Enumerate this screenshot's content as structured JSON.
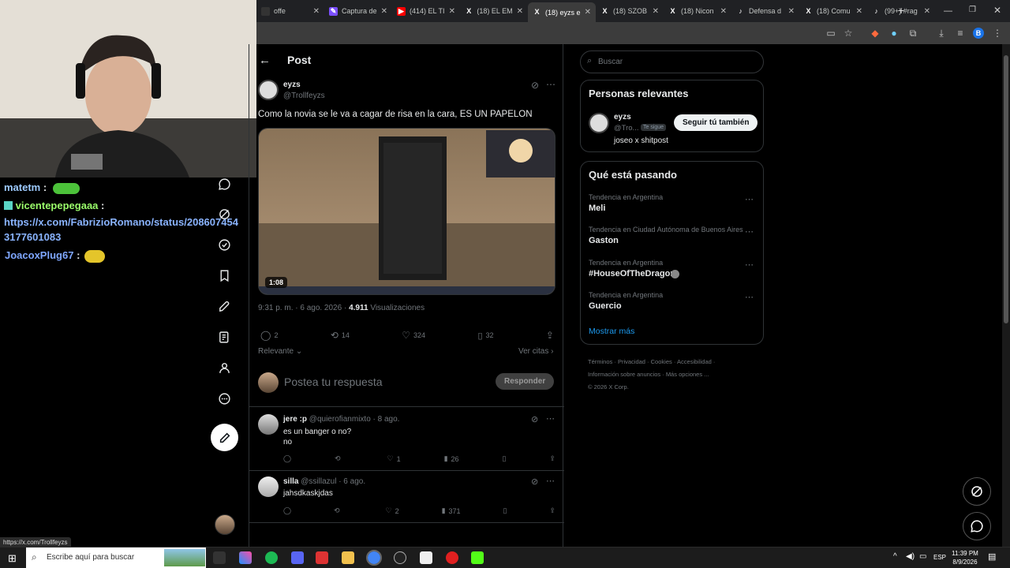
{
  "browser": {
    "tabs": [
      {
        "label": "offe",
        "icon": "generic-icon",
        "color": "#333"
      },
      {
        "label": "Captura de",
        "icon": "pen-icon",
        "color": "#7b4fff"
      },
      {
        "label": "(414) EL TI",
        "icon": "youtube-icon",
        "color": "#ff0000"
      },
      {
        "label": "(18) EL EM",
        "icon": "x-icon",
        "color": "#000"
      },
      {
        "label": "(18) eyzs e",
        "icon": "x-icon",
        "color": "#000",
        "active": true
      },
      {
        "label": "(18) SZOB",
        "icon": "x-icon",
        "color": "#000"
      },
      {
        "label": "(18) Nicon",
        "icon": "x-icon",
        "color": "#000"
      },
      {
        "label": "Defensa d",
        "icon": "tiktok-icon",
        "color": "#000"
      },
      {
        "label": "(18) Comu",
        "icon": "x-icon",
        "color": "#000"
      },
      {
        "label": "(99+) #rag",
        "icon": "tiktok-icon",
        "color": "#000"
      }
    ],
    "new_tab": "+",
    "profile_initial": "B"
  },
  "stream_chat": [
    {
      "user": "matetm",
      "color": "#9ecbff",
      "msg": ":",
      "emote": "green-emote"
    },
    {
      "user": "vicentepepegaaa",
      "color": "#9bff6b",
      "msg": ":",
      "badge": true
    },
    {
      "link": "https://x.com/FabrizioRomano/status/2086074543177601083"
    },
    {
      "user": "JoacoxPlug67",
      "color": "#7fa7ff",
      "msg": ":",
      "emote": "minion-emote"
    }
  ],
  "post": {
    "header": "Post",
    "author_name": "eyzs",
    "author_handle": "@Trollfeyzs",
    "text": "Como la novia se le va a cagar de risa en la cara, ES UN PAPELON",
    "video_duration": "1:08",
    "timestamp": "9:31 p. m. · 6 ago. 2026 · ",
    "views_count": "4.911",
    "views_label": "Visualizaciones",
    "replies": "2",
    "reposts": "14",
    "likes": "324",
    "bookmarks": "32",
    "sort_label": "Relevante",
    "quotes_label": "Ver citas",
    "reply_placeholder": "Postea tu respuesta",
    "reply_button": "Responder"
  },
  "replies": [
    {
      "name": "jere :p",
      "handle": "@quierofianmixto",
      "date": "· 8 ago.",
      "lines": [
        "es un banger o no?",
        "no"
      ],
      "reposts": "",
      "likes": "1",
      "views": "26"
    },
    {
      "name": "silla",
      "handle": "@ssillazul",
      "date": "· 6 ago.",
      "lines": [
        "jahsdkaskjdas"
      ],
      "reposts": "",
      "likes": "2",
      "views": "371"
    }
  ],
  "sidebar": {
    "search_placeholder": "Buscar",
    "relevant_title": "Personas relevantes",
    "relevant_name": "eyzs",
    "relevant_handle": "@Tro...",
    "follows_you": "Te sigue",
    "follow_button": "Seguir tú también",
    "relevant_bio": "joseo x shitpost",
    "trends_title": "Qué está pasando",
    "trends": [
      {
        "cat": "Tendencia en Argentina",
        "name": "Meli"
      },
      {
        "cat": "Tendencia en Ciudad Autónoma de Buenos Aires",
        "name": "Gaston"
      },
      {
        "cat": "Tendencia en Argentina",
        "name": "#HouseOfTheDragon"
      },
      {
        "cat": "Tendencia en Argentina",
        "name": "Guercio"
      }
    ],
    "show_more": "Mostrar más",
    "footer_line1": [
      "Términos",
      "Privacidad",
      "Cookies",
      "Accesibilidad"
    ],
    "footer_line2": [
      "Información sobre anuncios",
      "Más opciones ..."
    ],
    "copyright": "© 2026 X Corp."
  },
  "status_url": "https://x.com/Trollfeyzs",
  "taskbar": {
    "search_placeholder": "Escribe aquí para buscar",
    "language": "ESP",
    "time": "11:39 PM",
    "date": "8/9/2026"
  }
}
